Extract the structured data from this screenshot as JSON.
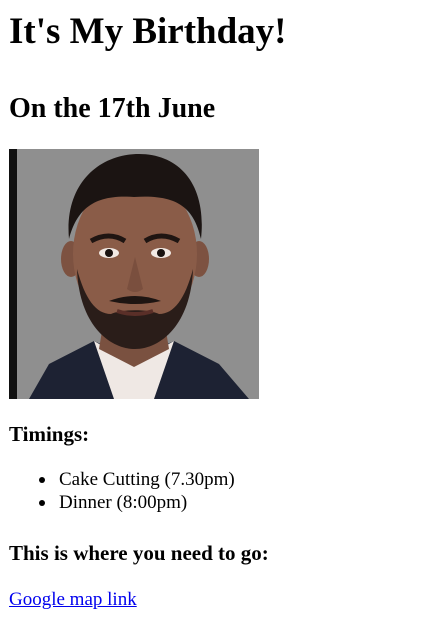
{
  "page": {
    "title": "It's My Birthday!",
    "date_heading": "On the 17th June",
    "photo": {
      "description_icon": "portrait-photo"
    },
    "timings": {
      "heading": "Timings:",
      "items": [
        {
          "label": "Cake Cutting (7.30pm)"
        },
        {
          "label": "Dinner (8:00pm)"
        }
      ]
    },
    "directions": {
      "heading": "This is where you need to go:",
      "link_label": "Google map link"
    }
  },
  "colors": {
    "text": "#000000",
    "link": "#0000ee",
    "photo_background": "#8e8e8e"
  }
}
